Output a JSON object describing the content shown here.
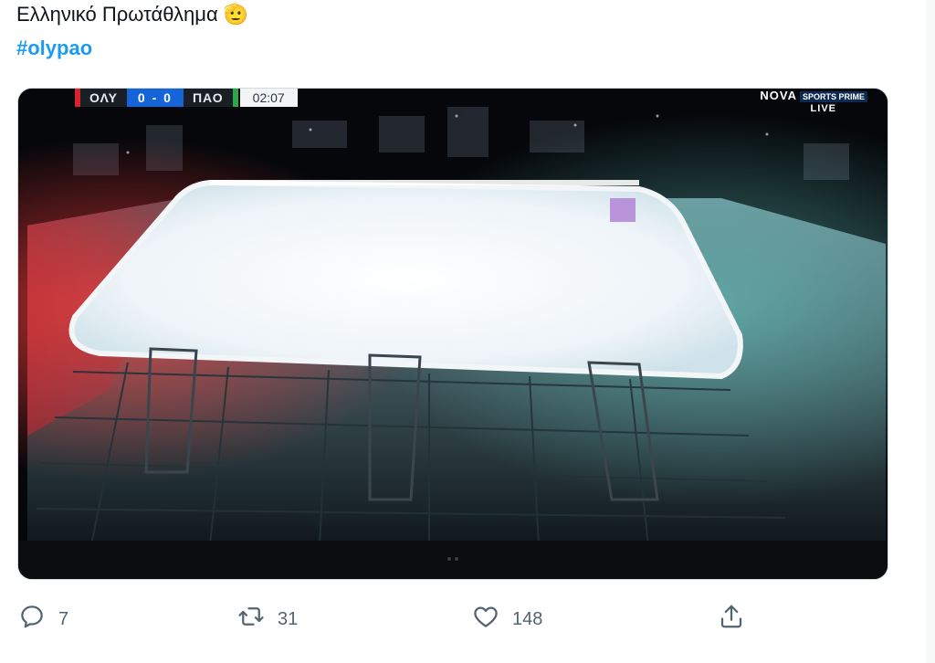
{
  "tweet": {
    "text": "Ελληνικό Πρωτάθλημα",
    "emoji": "🫡",
    "hashtag": "#olypao"
  },
  "media": {
    "scorebug": {
      "home": "ΟΛΥ",
      "score": "0 - 0",
      "away": "ΠΑΟ",
      "clock": "02:07"
    },
    "channel": {
      "brand": "NOVA",
      "sub": "SPORTS PRIME",
      "status": "LIVE"
    }
  },
  "actions": {
    "replies": "7",
    "retweets": "31",
    "likes": "148"
  },
  "icons": {
    "reply": "reply-icon",
    "retweet": "retweet-icon",
    "like": "heart-icon",
    "share": "share-icon"
  }
}
